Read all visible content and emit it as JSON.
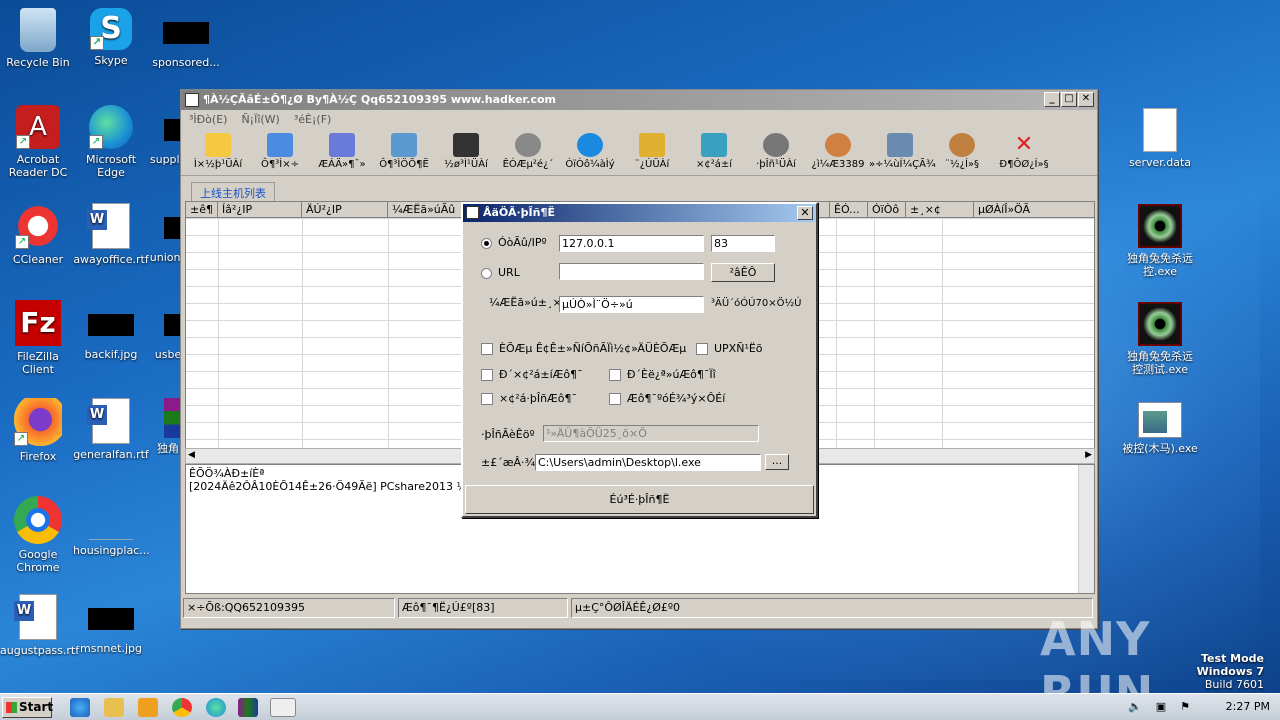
{
  "desktop": {
    "left_icons": [
      {
        "label": "Recycle Bin"
      },
      {
        "label": "Skype"
      },
      {
        "label": "sponsored..."
      },
      {
        "label": "Acrobat Reader DC"
      },
      {
        "label": "Microsoft Edge"
      },
      {
        "label": "supply"
      },
      {
        "label": "CCleaner"
      },
      {
        "label": "awayoffice.rtf"
      },
      {
        "label": "unions"
      },
      {
        "label": "FileZilla Client"
      },
      {
        "label": "backif.jpg"
      },
      {
        "label": "usbe"
      },
      {
        "label": "Firefox"
      },
      {
        "label": "generalfan.rtf"
      },
      {
        "label": "独角"
      },
      {
        "label": "Google Chrome"
      },
      {
        "label": "housingplac..."
      },
      {
        "label": "augustpass.rtf"
      },
      {
        "label": "msnnet.jpg"
      }
    ],
    "right_icons": [
      {
        "label": "server.data"
      },
      {
        "label": "独角兔免杀远控.exe"
      },
      {
        "label": "独角兔免杀远控测试.exe"
      },
      {
        "label": "被控(木马).exe"
      }
    ]
  },
  "window": {
    "title": "¶À½ÇÃâÉ±Ô¶¿Ø By¶À½Ç Qq652109395 www.hadker.com",
    "menu": [
      "³ÌÐò(E)",
      "Ñ¡Ïî(W)",
      "³éÈ¡(F)"
    ],
    "toolbar": [
      "Ì×½þ¹ÜÀí",
      "Ô¶³Ì×÷",
      "ÆÁÄ»¶¯»­",
      "Ô¶³ÌÖÕ¶Ë",
      "½ø³Ì¹ÜÀí",
      "ÊÓÆµ²é¿´",
      "ÓïÒô¼àÌý",
      "¨¿ÚÜÀí",
      "×¢²á±í",
      "·þÎñ¹ÜÀí",
      "¿ì¼Æ3389",
      "»÷¼ùÍ¼ÇÃ¾",
      "¨½¿Í»§",
      "Ð¶ÔØ¿Í»§"
    ],
    "tab": "上线主机列表",
    "columns": [
      "±ê¶",
      "Íâ²¿IP",
      "ÄÚ²¿IP",
      "¼ÆËã»úÃû",
      "",
      "",
      "",
      "",
      "ÊÓ...",
      "ÓïÒô",
      "±¸×¢",
      "µØÀíÎ»ÖÃ"
    ],
    "log_header": "ÊÕÖ¾ÀÐ±íÈª",
    "log_line": "[2024Äê2ÔÂ10ÈÕ14Ê±26·Ö49Ãë]  PCshare2013  ¼àÌý¶Ë...",
    "status": [
      "×÷Õß:QQ652109395",
      "Æô¶¯¶Ë¿Ú£º[83]",
      "µ±Ç°ÔØÎÄÉÊ¿Ø£º0"
    ]
  },
  "dialog": {
    "title": "ÅäÖÃ·þÎñ¶Ë",
    "ip_label": "ÓòÃû/IPº",
    "ip_value": "127.0.0.1",
    "port_value": "83",
    "url_label": "URL",
    "url_value": "",
    "test_btn": "²âÊÔ",
    "name_label": "¼ÆËã»ú±¸×¢",
    "name_value": "µÚÒ»Ì¨Ö÷»ú",
    "name_hint": "³ÄÜ´óÓÚ70×Ö½Ú",
    "opt1": "ÈÕÆµ  Ê¢Ê±»ÑíÕñÃÏì½¢»ÄÜÈÕÆµ",
    "opt2": "UPXÑ¹Ëõ",
    "opt3": "Ð´×¢²á±íÆô¶¯",
    "opt4": "Ð´Èë¿ª»úÆô¶¯Ïî",
    "opt5": "×¢²á·þÎñÆô¶¯",
    "opt6": "Æô¶¯ºóÉ¾³ý×ÔÉí",
    "service_label": "·þÎñÃèÊöº",
    "service_value": "¹»ÄÜ¶àÖÜ25¸ö×Ö",
    "path_label": "±£´æÂ·¾¶",
    "path_value": "C:\\Users\\admin\\Desktop\\l.exe",
    "browse_btn": "...",
    "gen_btn": "Éú³É·þÎñ¶Ë"
  },
  "taskbar": {
    "start": "Start",
    "clock": "2:27 PM"
  },
  "watermark": {
    "brand": "ANY RUN",
    "line1": "Test Mode",
    "line2": "Windows 7",
    "line3": "Build 7601"
  }
}
